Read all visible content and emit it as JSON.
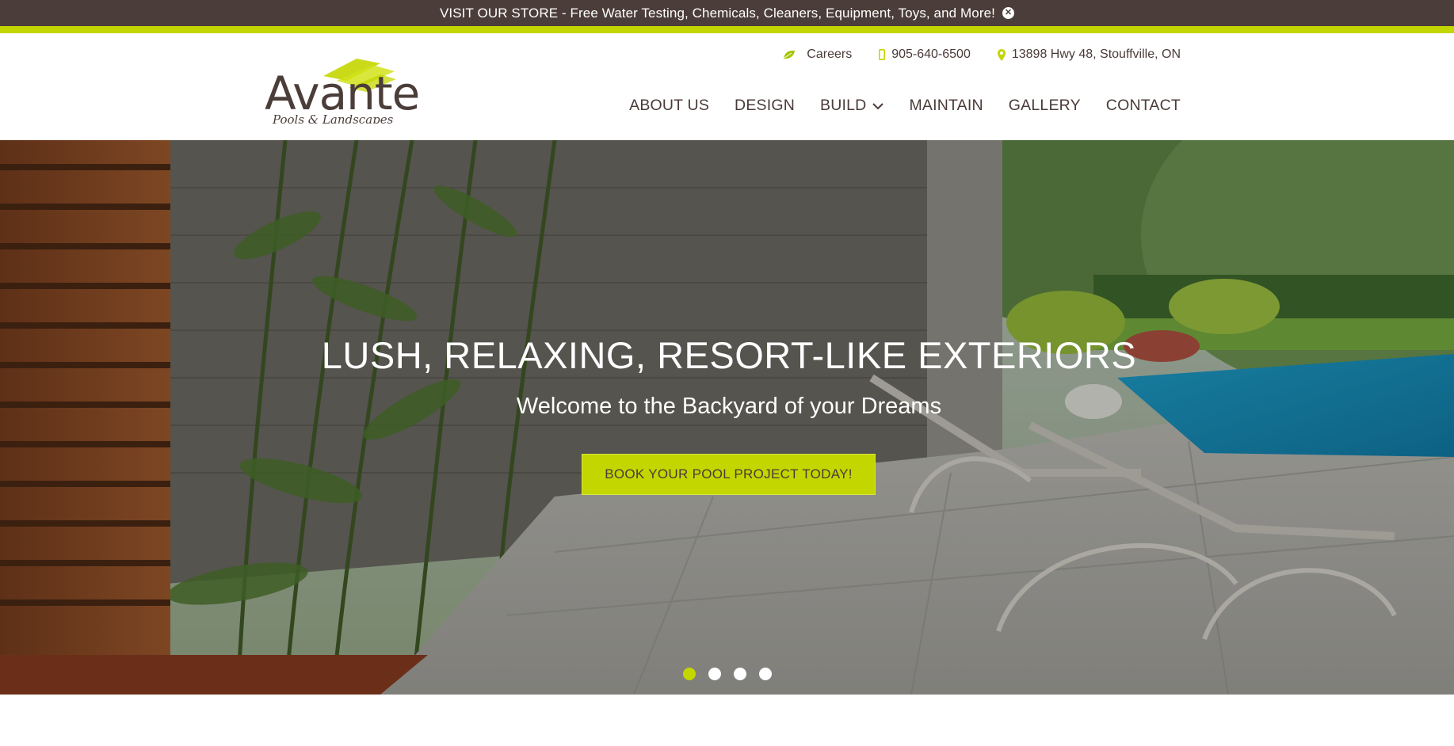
{
  "announcement": {
    "text": "VISIT OUR STORE - Free Water Testing, Chemicals, Cleaners, Equipment, Toys, and More!",
    "close_icon": "close-circle-icon"
  },
  "brand": {
    "name": "Avante",
    "tagline": "Pools & Landscapes",
    "accent_color": "#c4d600",
    "dark_color": "#4b3d39"
  },
  "contact": {
    "careers_label": "Careers",
    "careers_icon": "leaf-icon",
    "phone": "905-640-6500",
    "phone_icon": "mobile-phone-icon",
    "address": "13898 Hwy 48, Stouffville, ON",
    "address_icon": "map-pin-icon"
  },
  "nav": {
    "about": "ABOUT US",
    "design": "DESIGN",
    "build": "BUILD",
    "maintain": "MAINTAIN",
    "gallery": "GALLERY",
    "contact": "CONTACT"
  },
  "hero": {
    "title": "LUSH, RELAXING, RESORT-LIKE EXTERIORS",
    "subtitle": "Welcome to the Backyard of your Dreams",
    "cta": "BOOK YOUR POOL PROJECT TODAY!",
    "slides_total": 4,
    "active_slide": 1
  }
}
